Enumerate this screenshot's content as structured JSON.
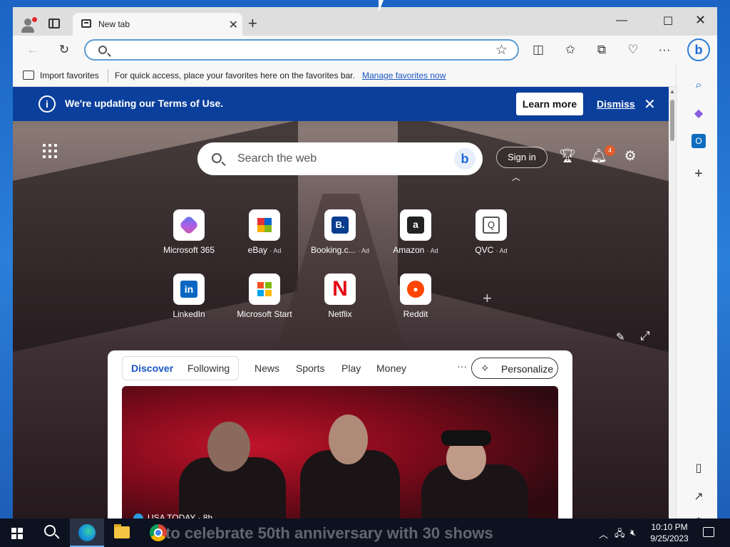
{
  "browser": {
    "tab_title": "New tab",
    "new_tab_symbol": "+",
    "address_value": "",
    "favorites_bar": {
      "import_label": "Import favorites",
      "message": "For quick access, place your favorites here on the favorites bar.",
      "manage_link": "Manage favorites now"
    }
  },
  "banner": {
    "message": "We're updating our Terms of Use.",
    "learn_more": "Learn more",
    "dismiss": "Dismiss"
  },
  "newtab": {
    "search_placeholder": "Search the web",
    "sign_in": "Sign in",
    "notification_count": "4",
    "quick_links": [
      {
        "label": "Microsoft 365",
        "ad": ""
      },
      {
        "label": "eBay",
        "ad": "· Ad"
      },
      {
        "label": "Booking.c...",
        "ad": "· Ad"
      },
      {
        "label": "Amazon",
        "ad": "· Ad"
      },
      {
        "label": "QVC",
        "ad": "· Ad"
      },
      {
        "label": "LinkedIn",
        "ad": ""
      },
      {
        "label": "Microsoft Start",
        "ad": ""
      },
      {
        "label": "Netflix",
        "ad": ""
      },
      {
        "label": "Reddit",
        "ad": ""
      }
    ],
    "icon_glyphs": {
      "booking": "B.",
      "amazon": "a",
      "qvc": "Q",
      "linkedin": "in",
      "netflix": "N"
    }
  },
  "feed": {
    "tabs": [
      "Discover",
      "Following",
      "News",
      "Sports",
      "Play",
      "Money"
    ],
    "active_tab": "Discover",
    "more": "···",
    "personalize": "Personalize",
    "story": {
      "source": "USA TODAY · 8h",
      "headline": "to celebrate 50th anniversary with 30 shows"
    }
  },
  "taskbar": {
    "time": "10:10 PM",
    "date": "9/25/2023"
  },
  "colors": {
    "banner_bg": "#0b3f9c",
    "accent": "#1a55c4"
  }
}
